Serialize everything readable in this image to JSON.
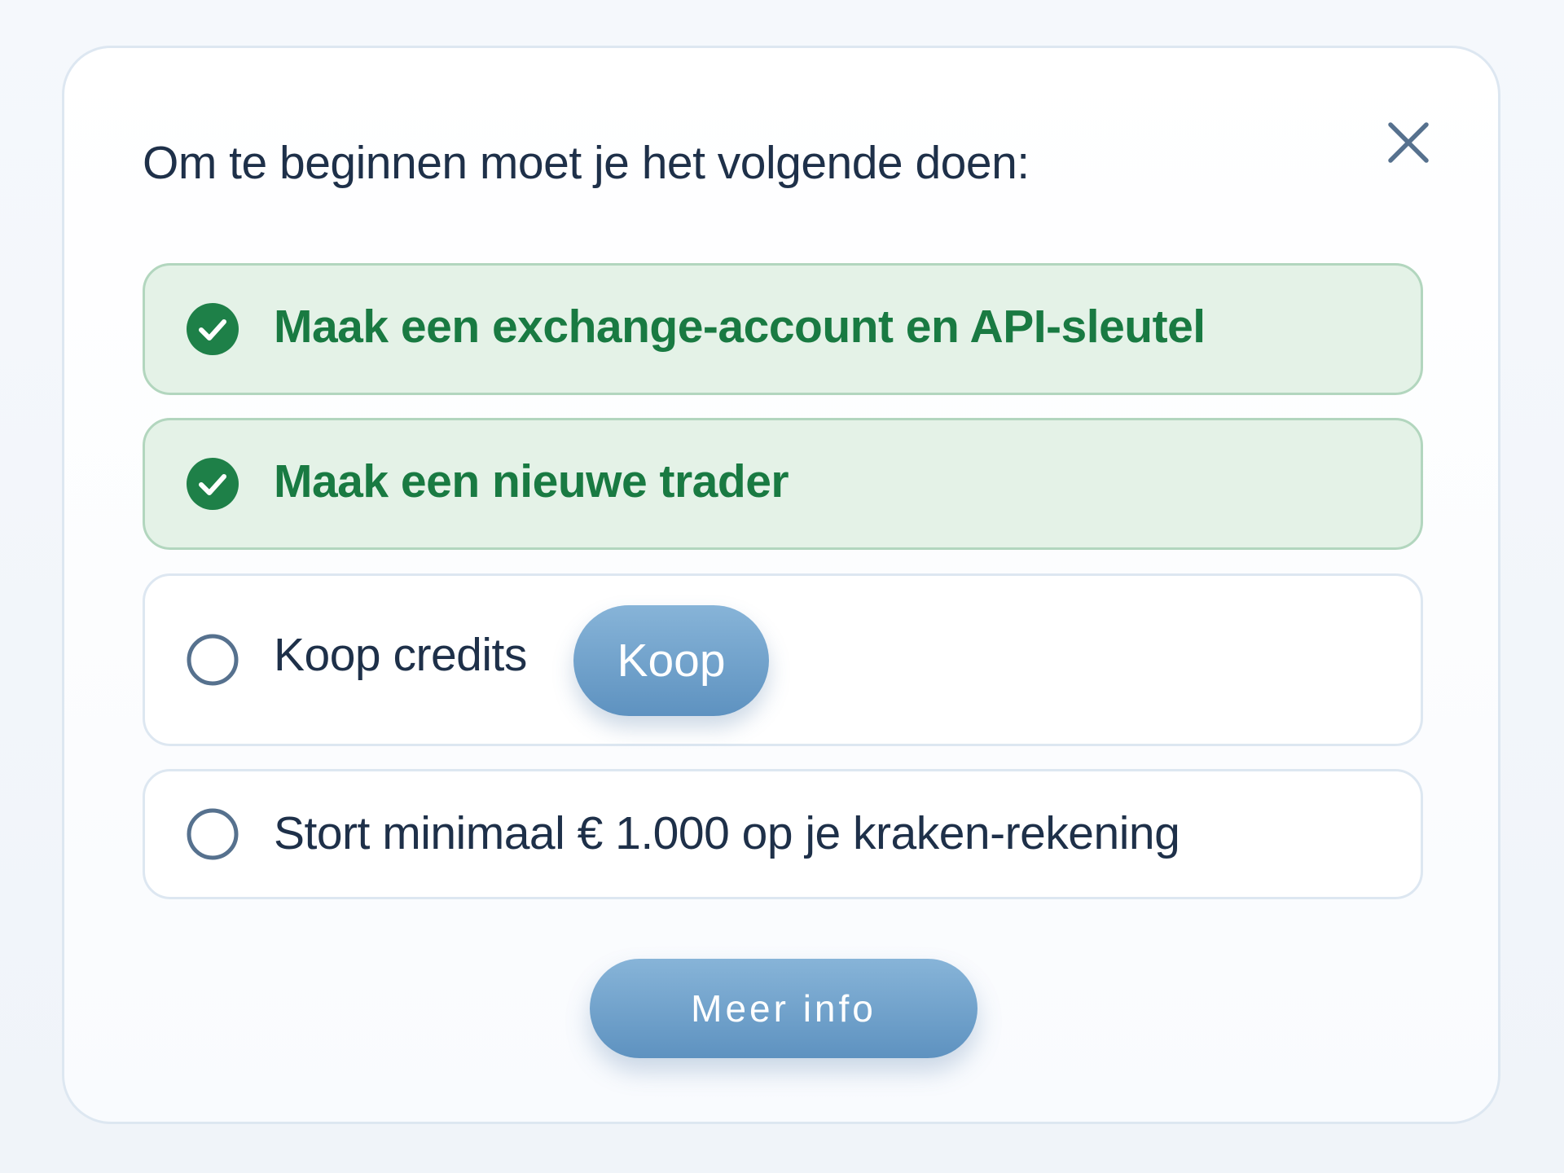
{
  "dialog": {
    "title": "Om te beginnen moet je het volgende doen:",
    "close_icon": "close-icon"
  },
  "steps": [
    {
      "label": "Maak een exchange-account en API-sleutel",
      "status": "done",
      "icon": "check-circle-icon"
    },
    {
      "label": "Maak een nieuwe trader",
      "status": "done",
      "icon": "check-circle-icon"
    },
    {
      "label": "Koop credits",
      "status": "todo",
      "icon": "empty-circle-icon",
      "action_label": "Koop"
    },
    {
      "label": "Stort minimaal € 1.000 op je kraken-rekening",
      "status": "todo",
      "icon": "empty-circle-icon"
    }
  ],
  "footer": {
    "more_info_label": "Meer info"
  },
  "colors": {
    "done_background": "#e4f2e7",
    "done_border": "#b2d6be",
    "done_text": "#197a42",
    "done_icon": "#1e8048",
    "todo_text": "#1e3049",
    "todo_icon_stroke": "#56718e",
    "button_gradient_top": "#87b4d8",
    "button_gradient_bottom": "#5e92c0"
  }
}
